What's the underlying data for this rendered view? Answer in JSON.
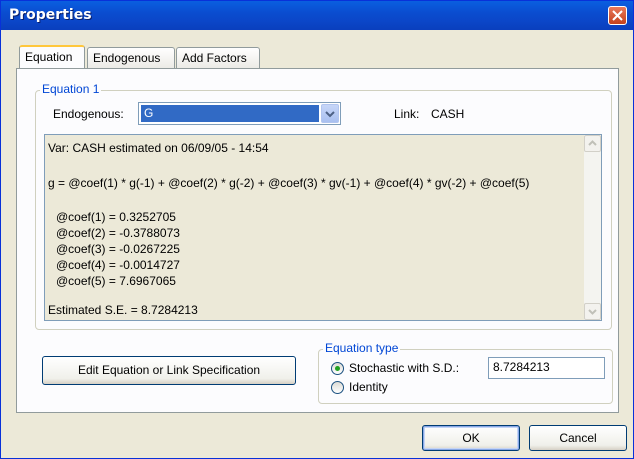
{
  "window": {
    "title": "Properties"
  },
  "tabs": [
    {
      "label": "Equation",
      "active": true
    },
    {
      "label": "Endogenous",
      "active": false
    },
    {
      "label": "Add Factors",
      "active": false
    }
  ],
  "equation_group": {
    "legend": "Equation 1",
    "endogenous_label": "Endogenous:",
    "endogenous_value": "G",
    "link_label": "Link:",
    "link_value": "CASH",
    "text_lines": [
      "Var: CASH estimated on 06/09/05 - 14:54",
      "g  = @coef(1) * g(-1)  + @coef(2) * g(-2)  + @coef(3) * gv(-1)  + @coef(4) * gv(-2)  + @coef(5)",
      "@coef(1) =  0.3252705",
      "@coef(2) = -0.3788073",
      "@coef(3) = -0.0267225",
      "@coef(4) = -0.0014727",
      "@coef(5) =  7.6967065",
      "Estimated S.E. =  8.7284213"
    ]
  },
  "edit_button": "Edit Equation or Link Specification",
  "equation_type": {
    "legend": "Equation type",
    "stochastic_label": "Stochastic with S.D.:",
    "stochastic_selected": true,
    "sd_value": "8.7284213",
    "identity_label": "Identity"
  },
  "buttons": {
    "ok": "OK",
    "cancel": "Cancel"
  },
  "colors": {
    "titlebar": "#0a4dd0",
    "selection": "#316ac5",
    "group_legend": "#0046d5",
    "radio_dot": "#21a121"
  }
}
